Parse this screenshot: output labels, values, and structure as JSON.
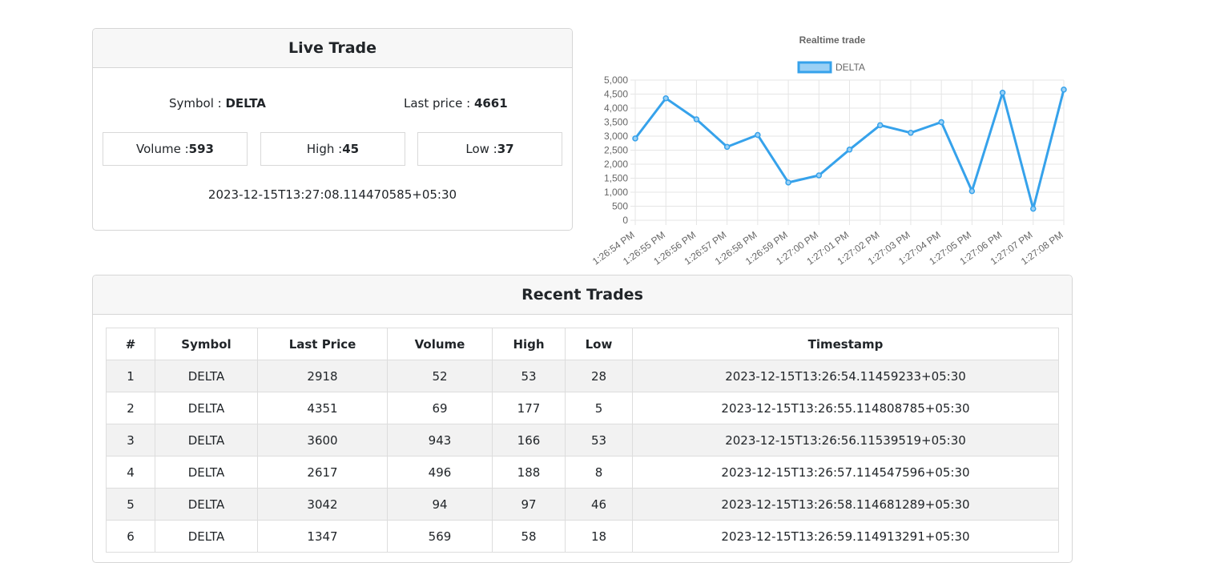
{
  "live": {
    "title": "Live Trade",
    "symbol_label": "Symbol : ",
    "symbol": "DELTA",
    "last_price_label": "Last price : ",
    "last_price": "4661",
    "volume_label": "Volume : ",
    "volume": "593",
    "high_label": "High : ",
    "high": "45",
    "low_label": "Low : ",
    "low": "37",
    "timestamp": "2023-12-15T13:27:08.114470585+05:30"
  },
  "recent": {
    "title": "Recent Trades",
    "headers": [
      "#",
      "Symbol",
      "Last Price",
      "Volume",
      "High",
      "Low",
      "Timestamp"
    ],
    "rows": [
      [
        "1",
        "DELTA",
        "2918",
        "52",
        "53",
        "28",
        "2023-12-15T13:26:54.11459233+05:30"
      ],
      [
        "2",
        "DELTA",
        "4351",
        "69",
        "177",
        "5",
        "2023-12-15T13:26:55.114808785+05:30"
      ],
      [
        "3",
        "DELTA",
        "3600",
        "943",
        "166",
        "53",
        "2023-12-15T13:26:56.11539519+05:30"
      ],
      [
        "4",
        "DELTA",
        "2617",
        "496",
        "188",
        "8",
        "2023-12-15T13:26:57.114547596+05:30"
      ],
      [
        "5",
        "DELTA",
        "3042",
        "94",
        "97",
        "46",
        "2023-12-15T13:26:58.114681289+05:30"
      ],
      [
        "6",
        "DELTA",
        "1347",
        "569",
        "58",
        "18",
        "2023-12-15T13:26:59.114913291+05:30"
      ]
    ]
  },
  "colors": {
    "line": "#36a2eb",
    "fill": "#9ad0f5",
    "grid": "#e5e5e5",
    "text": "#666666"
  },
  "chart_data": {
    "type": "line",
    "title": "Realtime trade",
    "x": [
      "1:26:54 PM",
      "1:26:55 PM",
      "1:26:56 PM",
      "1:26:57 PM",
      "1:26:58 PM",
      "1:26:59 PM",
      "1:27:00 PM",
      "1:27:01 PM",
      "1:27:02 PM",
      "1:27:03 PM",
      "1:27:04 PM",
      "1:27:05 PM",
      "1:27:06 PM",
      "1:27:07 PM",
      "1:27:08 PM"
    ],
    "series": [
      {
        "name": "DELTA",
        "values": [
          2918,
          4351,
          3600,
          2617,
          3042,
          1347,
          1600,
          2520,
          3390,
          3120,
          3500,
          1040,
          4550,
          410,
          4661
        ]
      }
    ],
    "yticks": [
      "0",
      "500",
      "1,000",
      "1,500",
      "2,000",
      "2,500",
      "3,000",
      "3,500",
      "4,000",
      "4,500",
      "5,000"
    ],
    "ylim": [
      0,
      5000
    ],
    "grid": true,
    "legend": "top"
  }
}
